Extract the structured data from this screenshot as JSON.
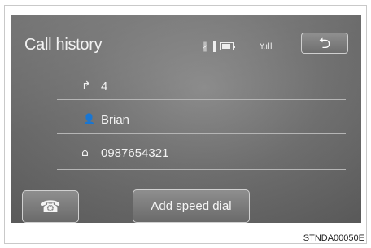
{
  "screen": {
    "title": "Call history",
    "status": {
      "bluetooth_icon": "bluetooth-icon",
      "battery_icon": "battery-icon",
      "signal_icon": "signal-strength-icon",
      "signal_label": "Y.ıll"
    },
    "back_button": {
      "icon": "back-arrow-icon",
      "glyph": "⮌"
    },
    "items": [
      {
        "icon": "outgoing-call-icon",
        "glyph": "↱",
        "text": "4"
      },
      {
        "icon": "person-icon",
        "glyph": "👤",
        "text": "Brian"
      },
      {
        "icon": "home-icon",
        "glyph": "⌂",
        "text": "0987654321"
      }
    ],
    "call_button": {
      "icon": "phone-icon",
      "glyph": "☎"
    },
    "speed_dial_button": {
      "label": "Add speed dial"
    }
  },
  "caption": "STNDA00050E"
}
